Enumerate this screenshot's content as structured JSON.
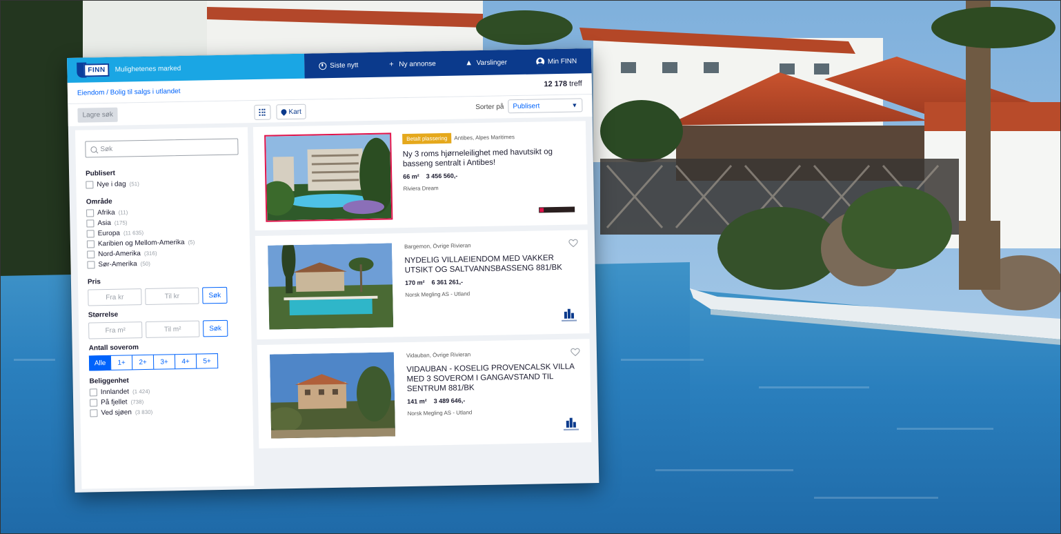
{
  "brand": {
    "logo_text": "FINN",
    "tagline": "Mulighetenes marked"
  },
  "nav": [
    {
      "icon": "clock-icon",
      "label": "Siste nytt"
    },
    {
      "icon": "plus-icon",
      "label": "Ny annonse"
    },
    {
      "icon": "bell-icon",
      "label": "Varslinger"
    },
    {
      "icon": "user-icon",
      "label": "Min FINN"
    }
  ],
  "breadcrumb": "Eiendom / Bolig til salgs i utlandet",
  "hits": {
    "count": "12 178",
    "label": "treff"
  },
  "save_search": "Lagre søk",
  "map_button": "Kart",
  "sort": {
    "label": "Sorter på",
    "value": "Publisert"
  },
  "filters": {
    "search_placeholder": "Søk",
    "published": {
      "title": "Publisert",
      "items": [
        {
          "label": "Nye i dag",
          "count": "(51)"
        }
      ]
    },
    "area": {
      "title": "Område",
      "items": [
        {
          "label": "Afrika",
          "count": "(11)"
        },
        {
          "label": "Asia",
          "count": "(175)"
        },
        {
          "label": "Europa",
          "count": "(11 635)"
        },
        {
          "label": "Karibien og Mellom-Amerika",
          "count": "(5)"
        },
        {
          "label": "Nord-Amerika",
          "count": "(316)"
        },
        {
          "label": "Sør-Amerika",
          "count": "(50)"
        }
      ]
    },
    "price": {
      "title": "Pris",
      "from": "Fra kr",
      "to": "Til kr",
      "button": "Søk"
    },
    "size": {
      "title": "Størrelse",
      "from": "Fra m²",
      "to": "Til m²",
      "button": "Søk"
    },
    "bedrooms": {
      "title": "Antall soverom",
      "options": [
        "Alle",
        "1+",
        "2+",
        "3+",
        "4+",
        "5+"
      ],
      "selected": "Alle"
    },
    "location": {
      "title": "Beliggenhet",
      "items": [
        {
          "label": "Innlandet",
          "count": "(1 424)"
        },
        {
          "label": "På fjellet",
          "count": "(738)"
        },
        {
          "label": "Ved sjøen",
          "count": "(3 830)"
        }
      ]
    }
  },
  "listings": [
    {
      "badge": "Betalt plassering",
      "location": "Antibes, Alpes Maritimes",
      "title": "Ny 3 roms hjørneleilighet med havutsikt og basseng sentralt i Antibes!",
      "size": "66 m²",
      "price": "3 456 560,-",
      "broker": "Riviera Dream",
      "highlighted": true
    },
    {
      "badge": "",
      "location": "Bargemon, Övrige Rivieran",
      "title": "NYDELIG VILLAEIENDOM MED VAKKER UTSIKT OG SALTVANNSBASSENG 881/BK",
      "size": "170 m²",
      "price": "6 361 261,-",
      "broker": "Norsk Megling AS - Utland",
      "highlighted": false
    },
    {
      "badge": "",
      "location": "Vidauban, Övrige Rivieran",
      "title": "VIDAUBAN - KOSELIG PROVENCALSK VILLA MED 3 SOVEROM I GANGAVSTAND TIL SENTRUM 881/BK",
      "size": "141 m²",
      "price": "3 489 646,-",
      "broker": "Norsk Megling AS - Utland",
      "highlighted": false
    }
  ],
  "colors": {
    "finn_blue": "#0063fb",
    "nav_dark": "#0b3a8c",
    "brand_light": "#1aa6e4",
    "badge": "#e5a81c",
    "highlight": "#e0134a"
  }
}
